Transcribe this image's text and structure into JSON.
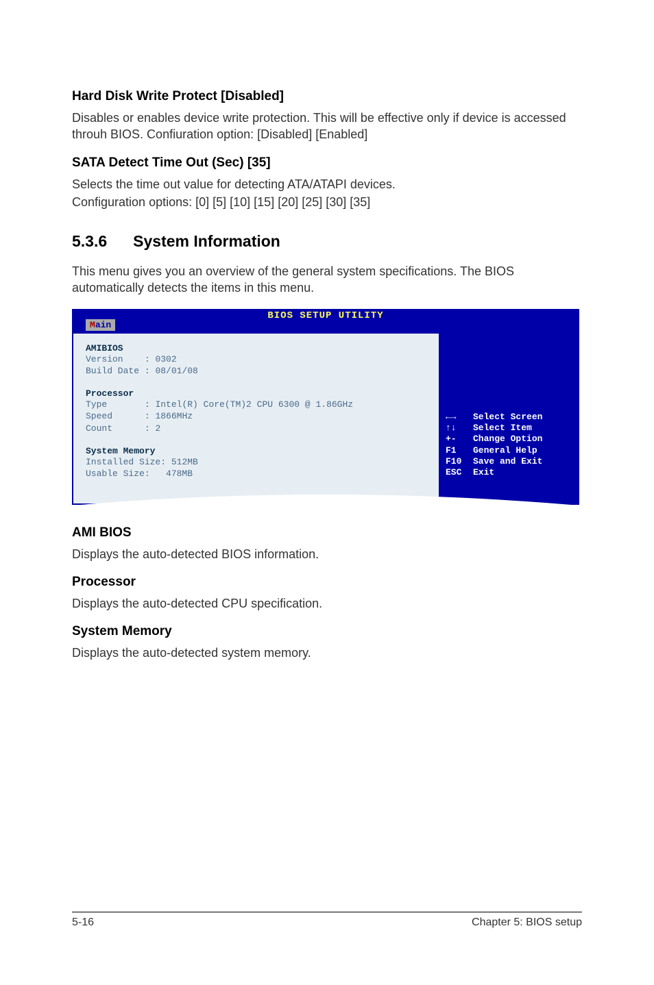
{
  "sections": {
    "hdwp": {
      "heading": "Hard Disk Write Protect [Disabled]",
      "body": "Disables or enables device write protection. This will be effective only if device is accessed throuh BIOS. Confiuration option: [Disabled] [Enabled]"
    },
    "sata": {
      "heading": "SATA Detect Time Out (Sec) [35]",
      "body1": "Selects the time out value for detecting ATA/ATAPI devices.",
      "body2": "Configuration options: [0] [5] [10] [15] [20] [25] [30] [35]"
    },
    "sysinfo": {
      "num": "5.3.6",
      "title": "System Information",
      "body": "This menu gives you an overview of the general system specifications. The BIOS automatically detects the items in this menu."
    },
    "amibios": {
      "heading": "AMI BIOS",
      "body": "Displays the auto-detected BIOS information."
    },
    "processor": {
      "heading": "Processor",
      "body": "Displays the auto-detected CPU specification."
    },
    "sysmem": {
      "heading": "System Memory",
      "body": "Displays the auto-detected system memory."
    }
  },
  "bios": {
    "titlebar": "BIOS SETUP UTILITY",
    "tab": "Main",
    "amibios": {
      "title": "AMIBIOS",
      "version_label": "Version    :",
      "version_value": "0302",
      "builddate_label": "Build Date :",
      "builddate_value": "08/01/08"
    },
    "processor": {
      "title": "Processor",
      "type_label": "Type       :",
      "type_value": "Intel(R) Core(TM)2 CPU 6300 @ 1.86GHz",
      "speed_label": "Speed      :",
      "speed_value": "1866MHz",
      "count_label": "Count      :",
      "count_value": "2"
    },
    "memory": {
      "title": "System Memory",
      "installed_label": "Installed Size:",
      "installed_value": "512MB",
      "usable_label": "Usable Size:  ",
      "usable_value": "478MB"
    },
    "help": [
      {
        "key": "←→",
        "action": "Select Screen"
      },
      {
        "key": "↑↓",
        "action": "Select Item"
      },
      {
        "key": "+-",
        "action": "Change Option"
      },
      {
        "key": "F1",
        "action": "General Help"
      },
      {
        "key": "F10",
        "action": "Save and Exit"
      },
      {
        "key": "ESC",
        "action": "Exit"
      }
    ]
  },
  "footer": {
    "left": "5-16",
    "right": "Chapter 5: BIOS setup"
  }
}
